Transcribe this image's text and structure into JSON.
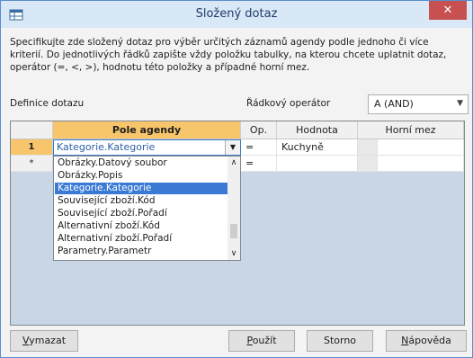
{
  "window": {
    "title": "Složený dotaz",
    "close_symbol": "✕",
    "description": "Specifikujte zde složený dotaz pro výběr určitých záznamů agendy podle jednoho či více kriterií. Do jednotlivých řádků zapište vždy položku tabulky, na kterou chcete uplatnit dotaz, operátor (=, <, >), hodnotu této položky a případné horní mez."
  },
  "labels": {
    "definition": "Definice dotazu",
    "row_operator": "Řádkový operátor"
  },
  "row_operator": {
    "value": "A (AND)"
  },
  "grid": {
    "columns": [
      "Pole agendy",
      "Op.",
      "Hodnota",
      "Horní mez"
    ],
    "rows": [
      {
        "marker": "1",
        "field": "Kategorie.Kategorie",
        "op": "=",
        "value": "Kuchyně",
        "upper": ""
      },
      {
        "marker": "*",
        "field": "",
        "op": "=",
        "value": "",
        "upper": ""
      }
    ],
    "dropdown_options": [
      "Obrázky.Datový soubor",
      "Obrázky.Popis",
      "Kategorie.Kategorie",
      "Související zboží.Kód",
      "Související zboží.Pořadí",
      "Alternativní zboží.Kód",
      "Alternativní zboží.Pořadí",
      "Parametry.Parametr"
    ],
    "selected_option_index": 2,
    "scroll_position": 0.65
  },
  "buttons": {
    "clear": {
      "prefix": "",
      "accel": "V",
      "rest": "ymazat"
    },
    "apply": {
      "prefix": "",
      "accel": "P",
      "rest": "oužít"
    },
    "cancel": {
      "label": "Storno"
    },
    "help": {
      "prefix": "",
      "accel": "N",
      "rest": "ápověda"
    }
  },
  "colors": {
    "accent": "#f7c56b",
    "selection": "#3a7ad5",
    "close": "#c75050"
  },
  "icons": {
    "app": "table-app-icon",
    "close": "close-icon",
    "dropdown": "chevron-down-icon",
    "scroll_up": "scroll-up-icon",
    "scroll_down": "scroll-down-icon"
  }
}
